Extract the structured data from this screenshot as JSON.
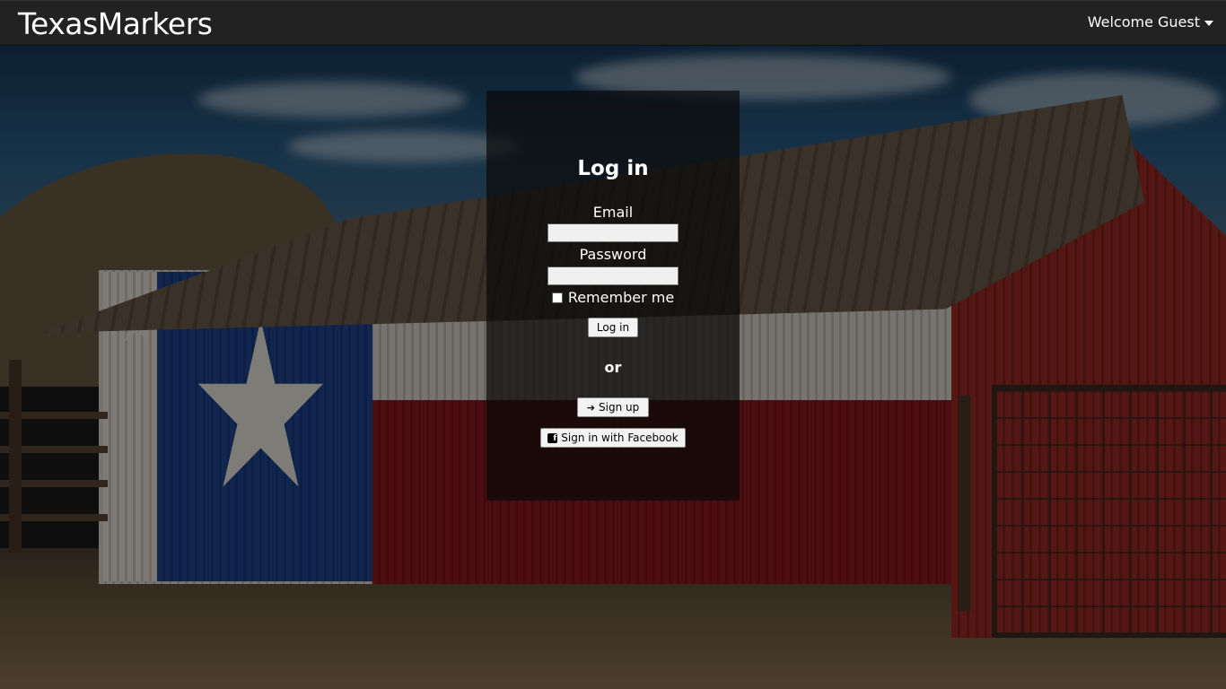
{
  "navbar": {
    "brand": "TexasMarkers",
    "user_menu_label": "Welcome Guest"
  },
  "login": {
    "title": "Log in",
    "email_label": "Email",
    "email_value": "",
    "password_label": "Password",
    "password_value": "",
    "remember_label": "Remember me",
    "remember_checked": false,
    "submit_label": "Log in",
    "or_text": "or",
    "signup_label": "Sign up",
    "facebook_label": "Sign in with Facebook"
  },
  "icons": {
    "user_menu": "caret-down-icon",
    "signup": "sign-in-icon",
    "facebook": "facebook-square-icon"
  },
  "colors": {
    "navbar_bg": "#222222",
    "panel_bg": "rgba(10,10,10,0.72)"
  }
}
